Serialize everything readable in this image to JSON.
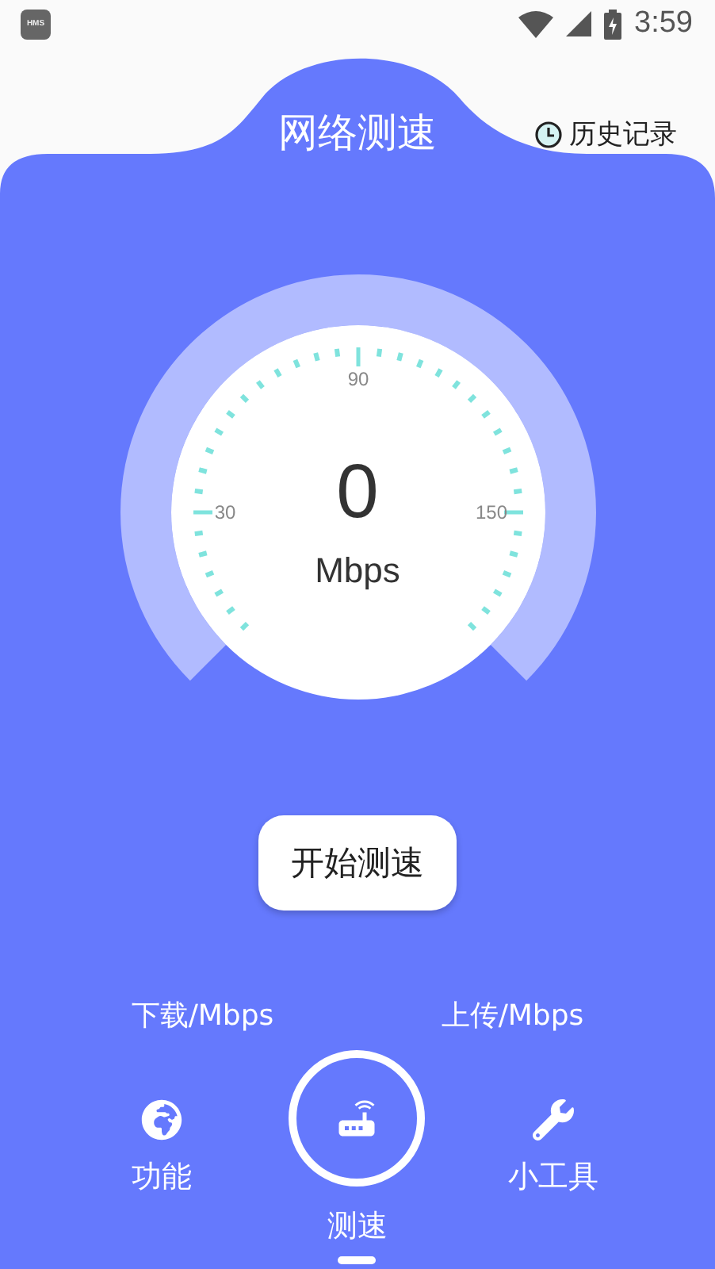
{
  "status_bar": {
    "app_badge": "HMS",
    "time": "3:59"
  },
  "header": {
    "title": "网络测速",
    "history": "历史记录"
  },
  "gauge": {
    "value": "0",
    "unit": "Mbps",
    "scale_labels": [
      "30",
      "90",
      "150"
    ]
  },
  "start_button": "开始测速",
  "stats": [
    {
      "label": "下载/Mbps"
    },
    {
      "label": "上传/Mbps"
    }
  ],
  "nav": [
    {
      "label": "功能",
      "kind": "globe",
      "selected": false
    },
    {
      "label": "测速",
      "kind": "router",
      "selected": true
    },
    {
      "label": "小工具",
      "kind": "wrench",
      "selected": false
    }
  ]
}
